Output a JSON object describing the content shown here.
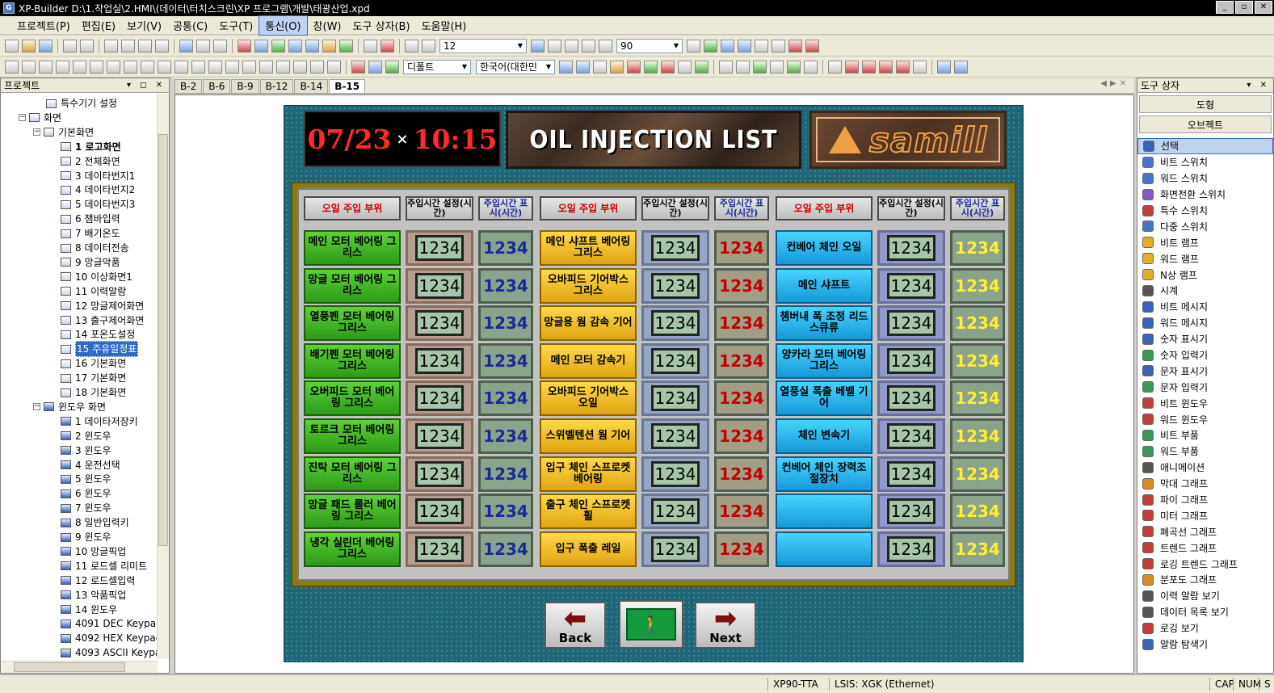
{
  "window": {
    "title": "XP-Builder D:\\1.작업실\\2.HMI\\(데이터\\터치스크린\\XP 프로그램\\개발\\태광산업.xpd"
  },
  "menu": [
    "프로젝트(P)",
    "편집(E)",
    "보기(V)",
    "공통(C)",
    "도구(T)",
    "통신(O)",
    "창(W)",
    "도구 상자(B)",
    "도움말(H)"
  ],
  "toolbar": {
    "zoom_font": "12",
    "zoom_percent": "90",
    "style": "디폴트",
    "language": "한국어(대한민"
  },
  "project": {
    "title": "프로젝트",
    "controls": "▾ ◻ ✕",
    "nodes": [
      "특수기기 설정",
      "화면",
      "기본화면",
      "1 로고화면",
      "2 전체화면",
      "3 데이타번지1",
      "4 데이타번지2",
      "5 데이타번지3",
      "6 챔바입력",
      "7 배기온도",
      "8 데이터전송",
      "9 망글악품",
      "10 이상화면1",
      "11 이력알람",
      "12 망글제어화면",
      "13 출구제어화면",
      "14 포온도설정",
      "15 주유일정표",
      "16 기본화면",
      "17 기본화면",
      "18 기본화면",
      "윈도우 화면",
      "1 데이타저장키",
      "2 윈도우",
      "3 윈도우",
      "4 운전선택",
      "5 윈도우",
      "6 윈도우",
      "7 윈도우",
      "8 일반입력키",
      "9 윈도우",
      "10 망글픽업",
      "11 로드셀 리미트",
      "12 로드셀입력",
      "13 악품픽업",
      "14 윈도우",
      "4091 DEC Keypac",
      "4092 HEX Keypac",
      "4093 ASCII Keypa"
    ]
  },
  "tabs": [
    "B-2",
    "B-6",
    "B-9",
    "B-12",
    "B-14",
    "B-15"
  ],
  "screen": {
    "date": "07/23",
    "time": "10:15",
    "separator": "×",
    "title": "OIL INJECTION LIST",
    "logo": "samill",
    "headers": {
      "location": "오일 주입 부위",
      "set_time": "주입시간 설정(시간)",
      "disp_time": "주입시간 표시(시간)"
    },
    "columns": [
      {
        "locations": [
          "메인 모터 베어링 그리스",
          "망글 모터 베어링 그리스",
          "열풍펜 모터 베어링 그리스",
          "배기펜 모터 베어링 그리스",
          "오버피드 모터 베어링 그리스",
          "토르크 모터 베어링 그리스",
          "진탁 모터 베어링 그리스",
          "망글 패드 롤러 베어링 그리스",
          "냉각 실린더 베어링 그리스"
        ],
        "set": "1234",
        "disp": "1234"
      },
      {
        "locations": [
          "메인 샤프트 베어링 그리스",
          "오바피드 기어박스 그리스",
          "망글용 웜 감속 기어",
          "메인 모터 감속기",
          "오바피드 기어박스 오일",
          "스위벨텐션 웜 기어",
          "입구 체인 스프로켓 베어링",
          "출구 체인 스프로켓 휠",
          "입구 폭출 레일"
        ],
        "set": "1234",
        "disp": "1234"
      },
      {
        "locations": [
          "컨베어 체인 오일",
          "메인 샤프트",
          "챔버내 폭 조정 리드 스큐류",
          "양카라 모터 베어링 그리스",
          "열풍실 폭출 베벨 기어",
          "체인 변속기",
          "컨베어 체인 장력조절장치",
          "",
          ""
        ],
        "set": "1234",
        "disp": "1234"
      }
    ],
    "nav": {
      "back": "Back",
      "next": "Next"
    }
  },
  "toolbox": {
    "title": "도구 상자",
    "btn_shape": "도형",
    "btn_object": "오브젝트",
    "items": [
      "선택",
      "비트 스위치",
      "워드 스위치",
      "화면전환 스위치",
      "특수 스위치",
      "다중 스위치",
      "비트 램프",
      "워드 램프",
      "N상 램프",
      "시계",
      "비트 메시지",
      "워드 메시지",
      "숫자 표시기",
      "숫자 입력기",
      "문자 표시기",
      "문자 입력기",
      "비트 윈도우",
      "워드 윈도우",
      "비트 부품",
      "워드 부품",
      "애니메이션",
      "막대 그래프",
      "파이 그래프",
      "미터 그래프",
      "폐곡선 그래프",
      "트렌드 그래프",
      "로깅 트렌드 그래프",
      "분포도 그래프",
      "이력 알람 보기",
      "데이터 목록 보기",
      "로깅 보기",
      "알람 탐색기"
    ]
  },
  "status": {
    "device": "XP90-TTA",
    "plc": "LSIS: XGK (Ethernet)",
    "cap": "CAP",
    "num": "NUM",
    "scrl": "S"
  }
}
